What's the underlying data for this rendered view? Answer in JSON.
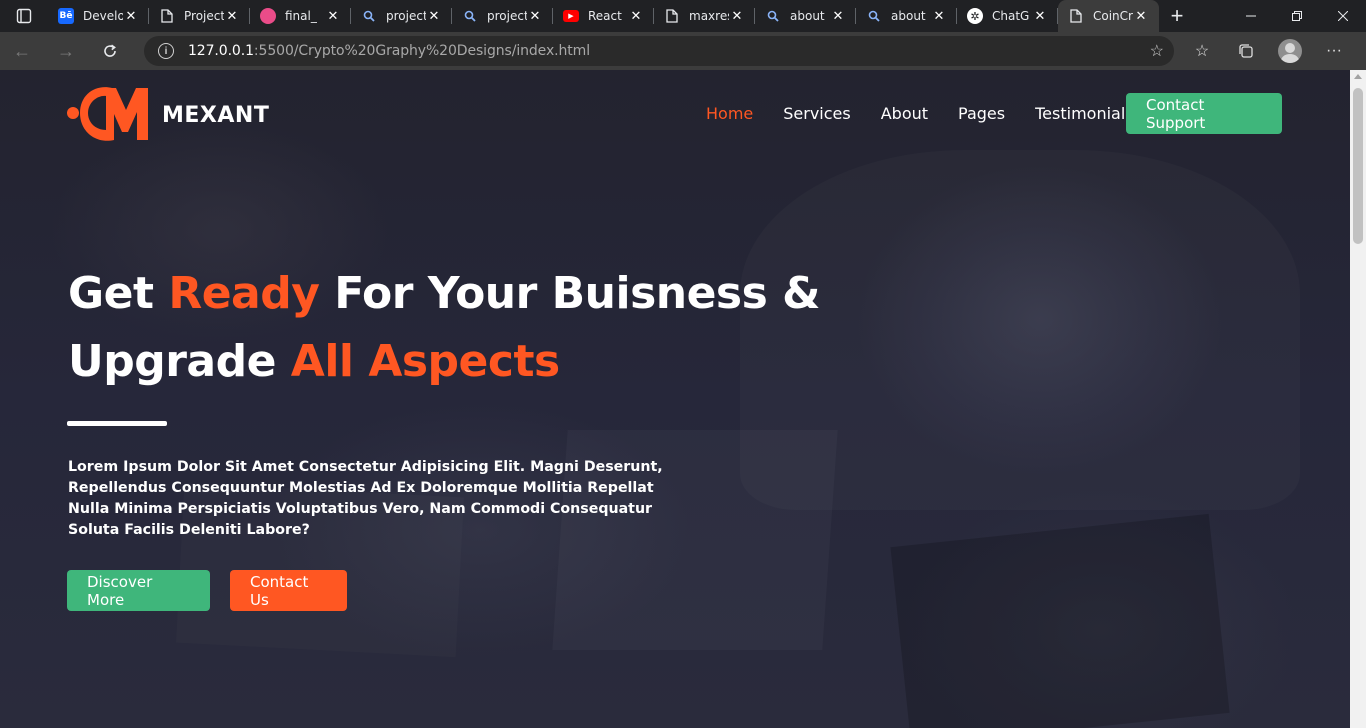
{
  "browser": {
    "tabs": [
      {
        "title": "Develo",
        "favicon": "behance-icon",
        "color": "#1769ff"
      },
      {
        "title": "Project",
        "favicon": "page-icon",
        "color": "#e8eaed"
      },
      {
        "title": "final_",
        "favicon": "dribbble-icon",
        "color": "#ea4c89"
      },
      {
        "title": "project",
        "favicon": "search-icon",
        "color": "#8ab4f8"
      },
      {
        "title": "project",
        "favicon": "search-icon",
        "color": "#8ab4f8"
      },
      {
        "title": "React",
        "favicon": "youtube-icon",
        "color": "#ff0000"
      },
      {
        "title": "maxres",
        "favicon": "page-icon",
        "color": "#e8eaed"
      },
      {
        "title": "about",
        "favicon": "search-icon",
        "color": "#8ab4f8"
      },
      {
        "title": "about",
        "favicon": "search-icon",
        "color": "#8ab4f8"
      },
      {
        "title": "ChatG",
        "favicon": "chatgpt-icon",
        "color": "#e8eaed"
      },
      {
        "title": "CoinCr",
        "favicon": "page-icon",
        "color": "#e8eaed",
        "active": true
      }
    ],
    "url_host": "127.0.0.1",
    "url_path": ":5500/Crypto%20Graphy%20Designs/index.html"
  },
  "site": {
    "brand": "MEXANT",
    "nav": [
      {
        "label": "Home",
        "active": true
      },
      {
        "label": "Services"
      },
      {
        "label": "About"
      },
      {
        "label": "Pages"
      },
      {
        "label": "Testimonials"
      }
    ],
    "support_button": "Contact Support"
  },
  "hero": {
    "title_1": "Get ",
    "title_accent_1": "Ready",
    "title_2": " For Your Buisness &",
    "title_3": "Upgrade ",
    "title_accent_2": "All Aspects",
    "description": "Lorem Ipsum Dolor Sit Amet Consectetur Adipisicing Elit. Magni Deserunt, Repellendus Consequuntur Molestias Ad Ex Doloremque Mollitia Repellat Nulla Minima Perspiciatis Voluptatibus Vero, Nam Commodi Consequatur Soluta Facilis Deleniti Labore?",
    "discover_button": "Discover More",
    "contact_button": "Contact Us"
  },
  "colors": {
    "accent": "#ff5722",
    "green": "#3fb67b"
  }
}
